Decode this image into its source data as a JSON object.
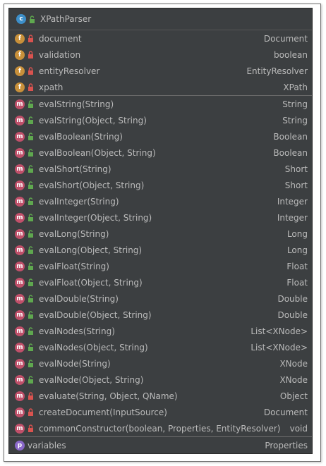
{
  "header": {
    "icon": "class-icon",
    "title": "XPathParser"
  },
  "fields": [
    {
      "name": "document",
      "type": "Document",
      "visibility": "private"
    },
    {
      "name": "validation",
      "type": "boolean",
      "visibility": "private"
    },
    {
      "name": "entityResolver",
      "type": "EntityResolver",
      "visibility": "private"
    },
    {
      "name": "xpath",
      "type": "XPath",
      "visibility": "private"
    }
  ],
  "methods": [
    {
      "name": "evalString(String)",
      "type": "String",
      "visibility": "public"
    },
    {
      "name": "evalString(Object, String)",
      "type": "String",
      "visibility": "public"
    },
    {
      "name": "evalBoolean(String)",
      "type": "Boolean",
      "visibility": "public"
    },
    {
      "name": "evalBoolean(Object, String)",
      "type": "Boolean",
      "visibility": "public"
    },
    {
      "name": "evalShort(String)",
      "type": "Short",
      "visibility": "public"
    },
    {
      "name": "evalShort(Object, String)",
      "type": "Short",
      "visibility": "public"
    },
    {
      "name": "evalInteger(String)",
      "type": "Integer",
      "visibility": "public"
    },
    {
      "name": "evalInteger(Object, String)",
      "type": "Integer",
      "visibility": "public"
    },
    {
      "name": "evalLong(String)",
      "type": "Long",
      "visibility": "public"
    },
    {
      "name": "evalLong(Object, String)",
      "type": "Long",
      "visibility": "public"
    },
    {
      "name": "evalFloat(String)",
      "type": "Float",
      "visibility": "public"
    },
    {
      "name": "evalFloat(Object, String)",
      "type": "Float",
      "visibility": "public"
    },
    {
      "name": "evalDouble(String)",
      "type": "Double",
      "visibility": "public"
    },
    {
      "name": "evalDouble(Object, String)",
      "type": "Double",
      "visibility": "public"
    },
    {
      "name": "evalNodes(String)",
      "type": "List<XNode>",
      "visibility": "public"
    },
    {
      "name": "evalNodes(Object, String)",
      "type": "List<XNode>",
      "visibility": "public"
    },
    {
      "name": "evalNode(String)",
      "type": "XNode",
      "visibility": "public"
    },
    {
      "name": "evalNode(Object, String)",
      "type": "XNode",
      "visibility": "public"
    },
    {
      "name": "evaluate(String, Object, QName)",
      "type": "Object",
      "visibility": "private"
    },
    {
      "name": "createDocument(InputSource)",
      "type": "Document",
      "visibility": "private"
    },
    {
      "name": "commonConstructor(boolean, Properties, EntityResolver)",
      "type": "void",
      "visibility": "private"
    }
  ],
  "properties": [
    {
      "name": "variables",
      "type": "Properties"
    }
  ],
  "colors": {
    "panel_bg": "#3c3f41",
    "text": "#bbbbbb",
    "class_icon": "#3d8fc9",
    "field_icon": "#c8903a",
    "method_icon": "#c0506a",
    "property_icon": "#8a68c9",
    "public_lock": "#5fa84f",
    "private_lock": "#d9534f"
  }
}
